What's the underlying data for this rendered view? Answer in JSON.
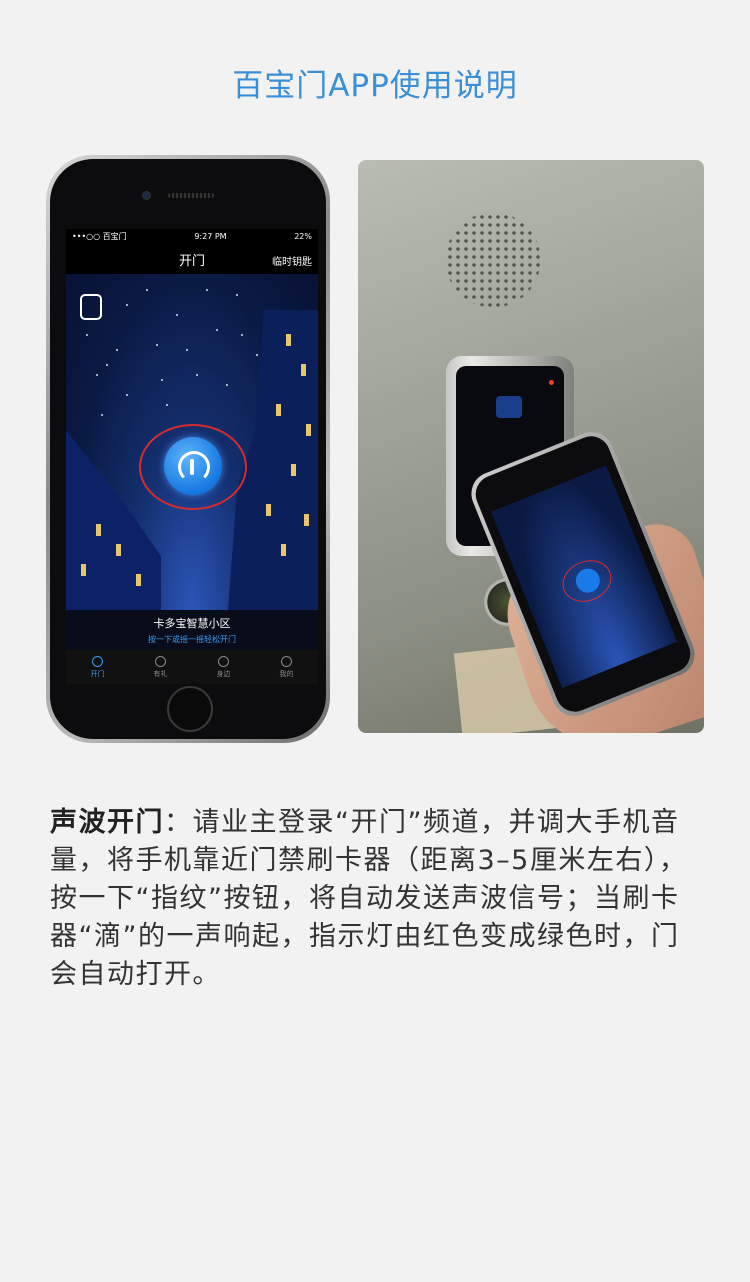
{
  "header": {
    "title": "百宝门APP使用说明"
  },
  "phone": {
    "status": {
      "carrier": "•••○○ 百宝门",
      "time": "9:27 PM",
      "battery": "22%"
    },
    "nav": {
      "title": "开门",
      "right_link": "临时钥匙"
    },
    "community_name": "卡多宝智慧小区",
    "hint": "按一下或摇一摇轻松开门",
    "tabs": [
      {
        "label": "开门",
        "icon": "door-icon",
        "active": true
      },
      {
        "label": "有礼",
        "icon": "gift-icon",
        "active": false
      },
      {
        "label": "身边",
        "icon": "location-icon",
        "active": false
      },
      {
        "label": "我的",
        "icon": "person-icon",
        "active": false
      }
    ]
  },
  "description": {
    "title": "声波开门",
    "body": "：请业主登录“开门”频道，并调大手机音量，将手机靠近门禁刷卡器（距离3–5厘米左右），按一下“指纹”按钮，将自动发送声波信号；当刷卡器“滴”的一声响起，指示灯由红色变成绿色时，门会自动打开。"
  },
  "colors": {
    "accent": "#3a8fd6",
    "highlight_ring": "#d62c2c",
    "fingerprint_button": "#1677e0"
  }
}
